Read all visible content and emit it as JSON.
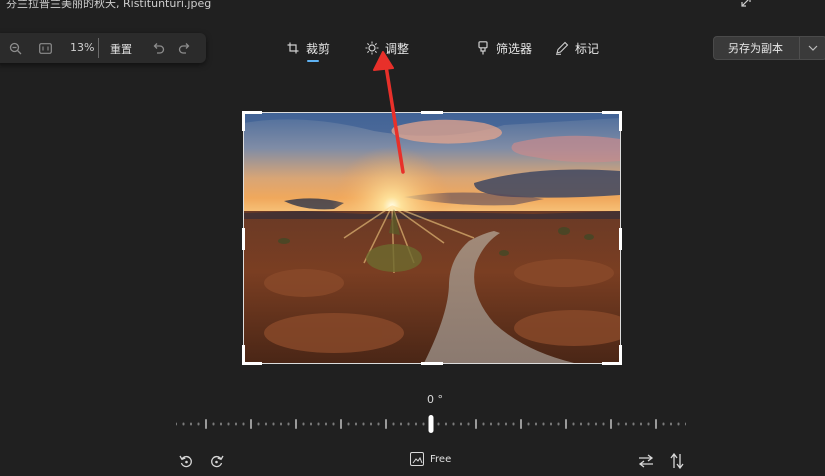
{
  "window": {
    "title": "芬兰拉普兰美丽的秋天, Ristitunturi.jpeg",
    "restore_icon": "restore-icon"
  },
  "zoom_toolbar": {
    "zoom_out_icon": "zoom-out-icon",
    "fit_icon": "fit-to-window-icon",
    "zoom_percent": "13%",
    "reset_label": "重置",
    "undo_icon": "undo-icon",
    "redo_icon": "redo-icon"
  },
  "tabs": [
    {
      "label": "裁剪",
      "icon": "crop-icon",
      "selected": true
    },
    {
      "label": "调整",
      "icon": "brightness-icon",
      "selected": false
    },
    {
      "label": "筛选器",
      "icon": "filter-icon",
      "selected": false
    },
    {
      "label": "标记",
      "icon": "markup-pen-icon",
      "selected": false
    }
  ],
  "save_button": {
    "label": "另存为副本",
    "dropdown_icon": "chevron-down-icon"
  },
  "rotation": {
    "angle_text": "0 °",
    "angle_value": 0
  },
  "bottom_bar": {
    "rotate_left_icon": "rotate-counterclockwise-icon",
    "rotate_right_icon": "rotate-clockwise-icon",
    "aspect_label": "Free",
    "aspect_icon": "aspect-ratio-icon",
    "flip_horizontal_icon": "flip-horizontal-icon",
    "flip_vertical_icon": "flip-vertical-icon"
  },
  "colors": {
    "background": "#202020",
    "accent": "#5fb2f2",
    "annotation_arrow": "#e8302a"
  }
}
